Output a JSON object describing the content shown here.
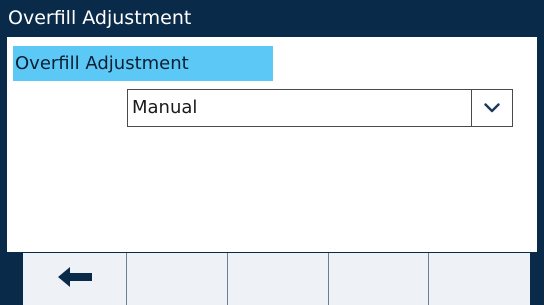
{
  "title_bar": {
    "title": "Overfill Adjustment"
  },
  "form": {
    "label": "Overfill Adjustment",
    "select": {
      "value": "Manual",
      "icon": "chevron-down-icon"
    }
  },
  "softkeys": [
    {
      "label": "",
      "icon": "arrow-left-icon"
    },
    {
      "label": ""
    },
    {
      "label": ""
    },
    {
      "label": ""
    },
    {
      "label": ""
    }
  ],
  "colors": {
    "title_bar_bg": "#0a2a4a",
    "label_highlight": "#5cc8f5",
    "softkey_bg": "#eef2f7"
  }
}
